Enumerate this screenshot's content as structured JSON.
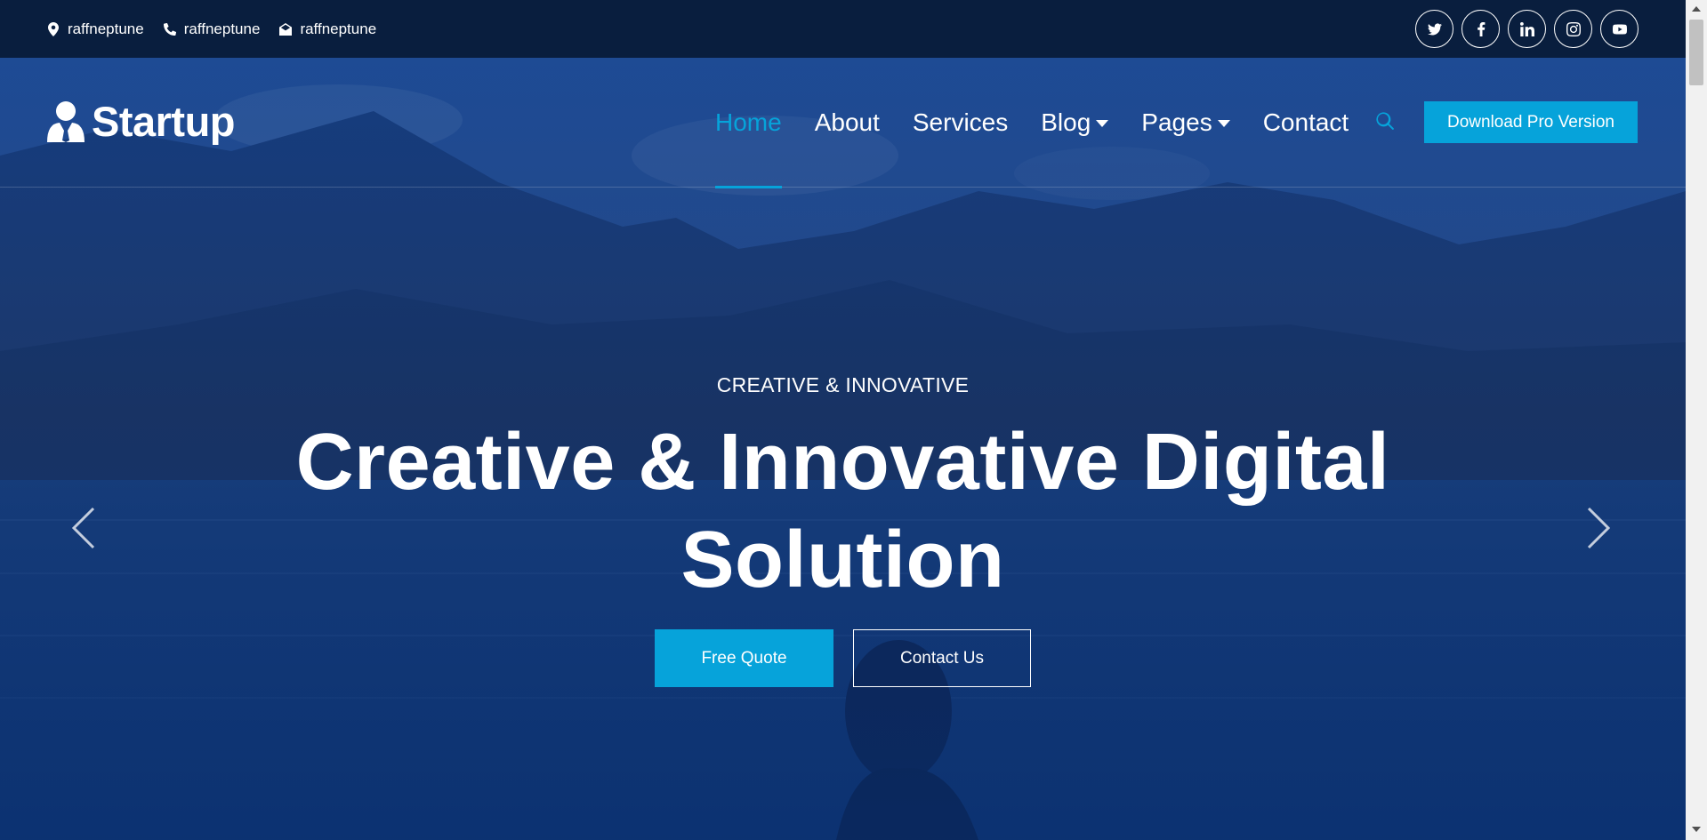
{
  "topbar": {
    "contacts": [
      {
        "icon": "location-icon",
        "label": "raffneptune"
      },
      {
        "icon": "phone-icon",
        "label": "raffneptune"
      },
      {
        "icon": "envelope-icon",
        "label": "raffneptune"
      }
    ],
    "socials": [
      "twitter-icon",
      "facebook-icon",
      "linkedin-icon",
      "instagram-icon",
      "youtube-icon"
    ]
  },
  "navbar": {
    "brand": "Startup",
    "links": [
      {
        "label": "Home",
        "active": true
      },
      {
        "label": "About"
      },
      {
        "label": "Services"
      },
      {
        "label": "Blog",
        "dropdown": true
      },
      {
        "label": "Pages",
        "dropdown": true
      },
      {
        "label": "Contact"
      }
    ],
    "cta": "Download Pro Version"
  },
  "hero": {
    "subtitle": "CREATIVE & INNOVATIVE",
    "title_line1": "Creative & Innovative Digital",
    "title_line2": "Solution",
    "primary_button": "Free Quote",
    "secondary_button": "Contact Us"
  },
  "colors": {
    "accent": "#06a3da",
    "topbar_bg": "#091e3e",
    "overlay": "#0a3a8a"
  }
}
